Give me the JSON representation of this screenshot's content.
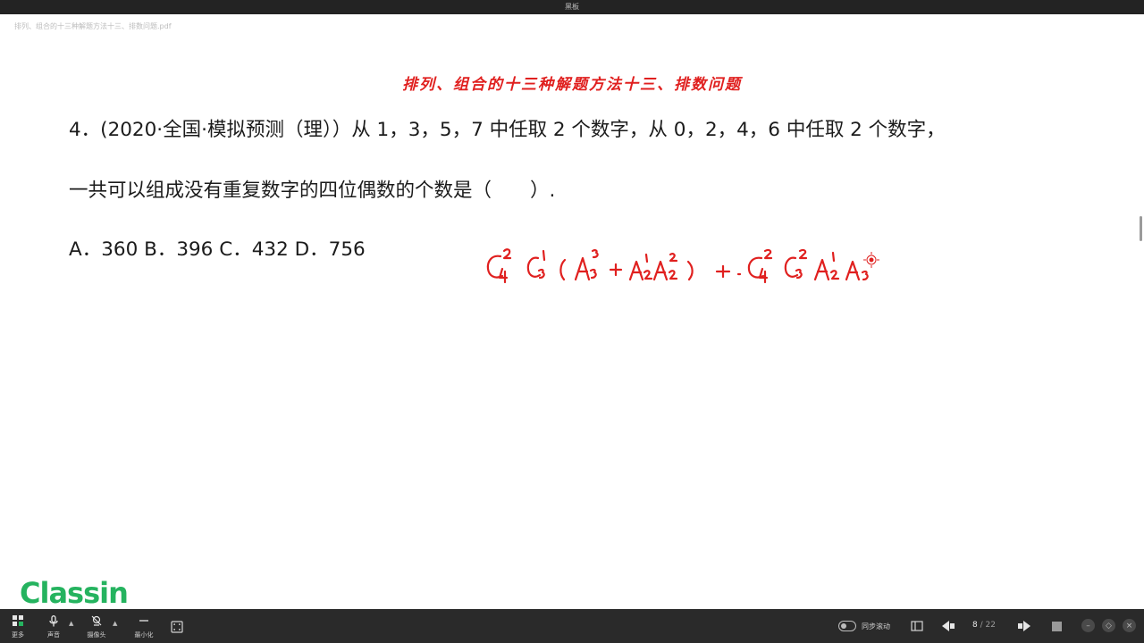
{
  "window": {
    "title": "黑板"
  },
  "doc_tab": {
    "filename": "排列、组合的十三种解题方法十三、排数问题.pdf"
  },
  "page": {
    "title": "排列、组合的十三种解题方法十三、排数问题",
    "question_line1": "4．(2020·全国·模拟预测（理））从 1，3，5，7 中任取 2 个数字，从 0，2，4，6 中任取 2 个数字，",
    "question_line2": "一共可以组成没有重复数字的四位偶数的个数是（　　）.",
    "options_line": "A．360 B．396 C．432 D．756",
    "handwriting_formula": "C₄²C₃¹(A₃³+A₂¹A₂²) + C₄²C₃²A₂¹A₃",
    "handwriting_color": "#e0201f"
  },
  "branding": {
    "logo": "Classin",
    "logo_color": "#25b35f"
  },
  "toolbar": {
    "more_label": "更多",
    "sound_label": "声音",
    "camera_label": "摄像头",
    "minimize_label": "最小化",
    "sync_label": "同步滚动",
    "current_page": "8",
    "page_sep": " / ",
    "total_pages": "22"
  },
  "icons": {
    "more": "grid-icon",
    "sound": "microphone-icon",
    "camera": "camera-icon",
    "minimize": "minimize-icon",
    "fit": "fit-screen-icon",
    "panel": "panel-icon",
    "prev": "prev-page-icon",
    "next": "next-page-icon",
    "fullscreen": "fullscreen-icon"
  }
}
